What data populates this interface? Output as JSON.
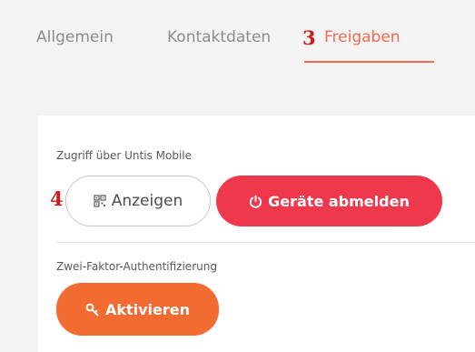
{
  "tabs": [
    {
      "label": "Allgemein",
      "active": false
    },
    {
      "label": "Kontaktdaten",
      "active": false
    },
    {
      "label": "Freigaben",
      "active": true
    }
  ],
  "annotations": {
    "tab_marker": "3",
    "button_marker": "4"
  },
  "mobile_access": {
    "label": "Zugriff über Untis Mobile",
    "show_button": {
      "label": "Anzeigen",
      "icon": "qr-code-icon"
    },
    "logout_button": {
      "label": "Geräte abmelden",
      "icon": "power-icon"
    }
  },
  "two_factor": {
    "label": "Zwei-Faktor-Authentifizierung",
    "activate_button": {
      "label": "Aktivieren",
      "icon": "key-icon"
    }
  },
  "colors": {
    "accent": "#f26b4d",
    "logout_button": "#f0384d",
    "activate_button": "#f26b30",
    "annotation_red": "#d11a1a"
  }
}
